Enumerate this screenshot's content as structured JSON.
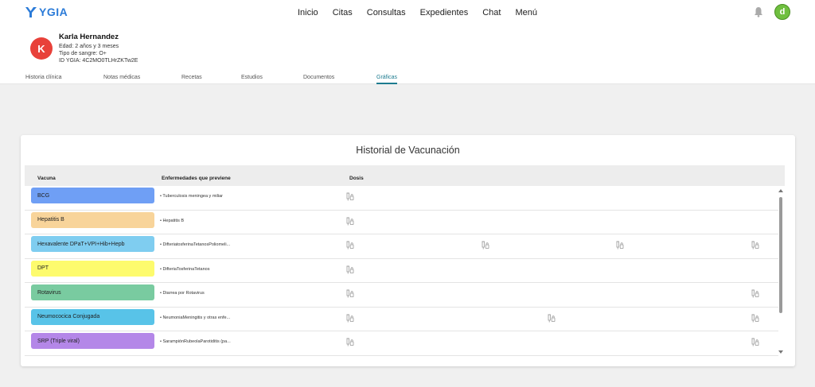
{
  "app": {
    "logo_text": "YGIA",
    "brand_color": "#2b7bd8"
  },
  "nav": {
    "items": [
      "Inicio",
      "Citas",
      "Consultas",
      "Expedientes",
      "Chat",
      "Menú"
    ]
  },
  "user": {
    "initial": "d"
  },
  "patient": {
    "initial": "K",
    "name": "Karla Hernandez",
    "age": "Edad: 2 años y 3 meses",
    "blood": "Tipo de sangre: O+",
    "id": "ID YGIA: 4C2MO0TLHrZKTw2E"
  },
  "tabs": [
    "Historia clínica",
    "Notas médicas",
    "Recetas",
    "Estudios",
    "Documentos",
    "Gráficas"
  ],
  "active_tab": "Gráficas",
  "card": {
    "title": "Historial de Vacunación",
    "headers": {
      "vaccine": "Vacuna",
      "diseases": "Enfermedades que previene",
      "doses": "Dosis"
    }
  },
  "vaccines": [
    {
      "name": "BCG",
      "color": "#6f9ff5",
      "disease": "• Tuberculosis meningea y miliar",
      "doses": 1
    },
    {
      "name": "Hepatitis B",
      "color": "#f8d49a",
      "disease": "• Hepatitis B",
      "doses": 1
    },
    {
      "name": "Hexavalente DPaT+VPI+Hib+Hepb",
      "color": "#7fcdf0",
      "disease": "• DifteriatosferinaTetanosPoliomeli...",
      "doses": 4
    },
    {
      "name": "DPT",
      "color": "#fdfb6d",
      "disease": "• DifteriaTosferinaTetanos",
      "doses": 1
    },
    {
      "name": "Rotavirus",
      "color": "#79cba0",
      "disease": "• Diarrea por Rotavirus",
      "doses": 2
    },
    {
      "name": "Neumococica Conjugada",
      "color": "#58c3e8",
      "disease": "• NeumoniaMeningitis y otras enfe...",
      "doses": 3
    },
    {
      "name": "SRP (Triple viral)",
      "color": "#b487e8",
      "disease": "• SarampiónRubeolaParotiditis (pa...",
      "doses": 2
    }
  ]
}
